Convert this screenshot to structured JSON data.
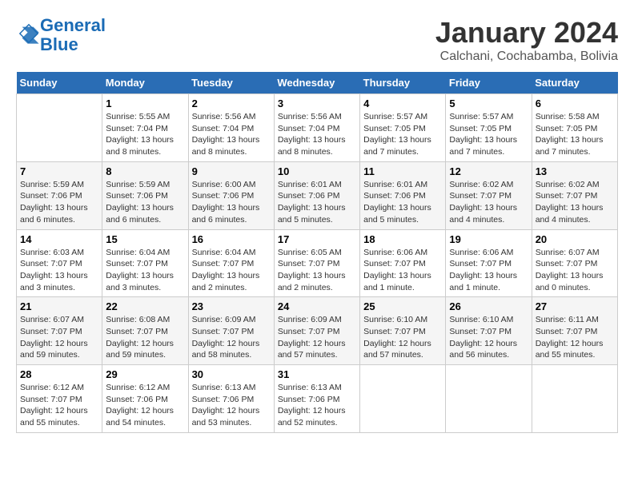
{
  "header": {
    "logo_line1": "General",
    "logo_line2": "Blue",
    "month_year": "January 2024",
    "location": "Calchani, Cochabamba, Bolivia"
  },
  "columns": [
    "Sunday",
    "Monday",
    "Tuesday",
    "Wednesday",
    "Thursday",
    "Friday",
    "Saturday"
  ],
  "weeks": [
    [
      {
        "num": "",
        "info": ""
      },
      {
        "num": "1",
        "info": "Sunrise: 5:55 AM\nSunset: 7:04 PM\nDaylight: 13 hours\nand 8 minutes."
      },
      {
        "num": "2",
        "info": "Sunrise: 5:56 AM\nSunset: 7:04 PM\nDaylight: 13 hours\nand 8 minutes."
      },
      {
        "num": "3",
        "info": "Sunrise: 5:56 AM\nSunset: 7:04 PM\nDaylight: 13 hours\nand 8 minutes."
      },
      {
        "num": "4",
        "info": "Sunrise: 5:57 AM\nSunset: 7:05 PM\nDaylight: 13 hours\nand 7 minutes."
      },
      {
        "num": "5",
        "info": "Sunrise: 5:57 AM\nSunset: 7:05 PM\nDaylight: 13 hours\nand 7 minutes."
      },
      {
        "num": "6",
        "info": "Sunrise: 5:58 AM\nSunset: 7:05 PM\nDaylight: 13 hours\nand 7 minutes."
      }
    ],
    [
      {
        "num": "7",
        "info": "Sunrise: 5:59 AM\nSunset: 7:06 PM\nDaylight: 13 hours\nand 6 minutes."
      },
      {
        "num": "8",
        "info": "Sunrise: 5:59 AM\nSunset: 7:06 PM\nDaylight: 13 hours\nand 6 minutes."
      },
      {
        "num": "9",
        "info": "Sunrise: 6:00 AM\nSunset: 7:06 PM\nDaylight: 13 hours\nand 6 minutes."
      },
      {
        "num": "10",
        "info": "Sunrise: 6:01 AM\nSunset: 7:06 PM\nDaylight: 13 hours\nand 5 minutes."
      },
      {
        "num": "11",
        "info": "Sunrise: 6:01 AM\nSunset: 7:06 PM\nDaylight: 13 hours\nand 5 minutes."
      },
      {
        "num": "12",
        "info": "Sunrise: 6:02 AM\nSunset: 7:07 PM\nDaylight: 13 hours\nand 4 minutes."
      },
      {
        "num": "13",
        "info": "Sunrise: 6:02 AM\nSunset: 7:07 PM\nDaylight: 13 hours\nand 4 minutes."
      }
    ],
    [
      {
        "num": "14",
        "info": "Sunrise: 6:03 AM\nSunset: 7:07 PM\nDaylight: 13 hours\nand 3 minutes."
      },
      {
        "num": "15",
        "info": "Sunrise: 6:04 AM\nSunset: 7:07 PM\nDaylight: 13 hours\nand 3 minutes."
      },
      {
        "num": "16",
        "info": "Sunrise: 6:04 AM\nSunset: 7:07 PM\nDaylight: 13 hours\nand 2 minutes."
      },
      {
        "num": "17",
        "info": "Sunrise: 6:05 AM\nSunset: 7:07 PM\nDaylight: 13 hours\nand 2 minutes."
      },
      {
        "num": "18",
        "info": "Sunrise: 6:06 AM\nSunset: 7:07 PM\nDaylight: 13 hours\nand 1 minute."
      },
      {
        "num": "19",
        "info": "Sunrise: 6:06 AM\nSunset: 7:07 PM\nDaylight: 13 hours\nand 1 minute."
      },
      {
        "num": "20",
        "info": "Sunrise: 6:07 AM\nSunset: 7:07 PM\nDaylight: 13 hours\nand 0 minutes."
      }
    ],
    [
      {
        "num": "21",
        "info": "Sunrise: 6:07 AM\nSunset: 7:07 PM\nDaylight: 12 hours\nand 59 minutes."
      },
      {
        "num": "22",
        "info": "Sunrise: 6:08 AM\nSunset: 7:07 PM\nDaylight: 12 hours\nand 59 minutes."
      },
      {
        "num": "23",
        "info": "Sunrise: 6:09 AM\nSunset: 7:07 PM\nDaylight: 12 hours\nand 58 minutes."
      },
      {
        "num": "24",
        "info": "Sunrise: 6:09 AM\nSunset: 7:07 PM\nDaylight: 12 hours\nand 57 minutes."
      },
      {
        "num": "25",
        "info": "Sunrise: 6:10 AM\nSunset: 7:07 PM\nDaylight: 12 hours\nand 57 minutes."
      },
      {
        "num": "26",
        "info": "Sunrise: 6:10 AM\nSunset: 7:07 PM\nDaylight: 12 hours\nand 56 minutes."
      },
      {
        "num": "27",
        "info": "Sunrise: 6:11 AM\nSunset: 7:07 PM\nDaylight: 12 hours\nand 55 minutes."
      }
    ],
    [
      {
        "num": "28",
        "info": "Sunrise: 6:12 AM\nSunset: 7:07 PM\nDaylight: 12 hours\nand 55 minutes."
      },
      {
        "num": "29",
        "info": "Sunrise: 6:12 AM\nSunset: 7:06 PM\nDaylight: 12 hours\nand 54 minutes."
      },
      {
        "num": "30",
        "info": "Sunrise: 6:13 AM\nSunset: 7:06 PM\nDaylight: 12 hours\nand 53 minutes."
      },
      {
        "num": "31",
        "info": "Sunrise: 6:13 AM\nSunset: 7:06 PM\nDaylight: 12 hours\nand 52 minutes."
      },
      {
        "num": "",
        "info": ""
      },
      {
        "num": "",
        "info": ""
      },
      {
        "num": "",
        "info": ""
      }
    ]
  ]
}
